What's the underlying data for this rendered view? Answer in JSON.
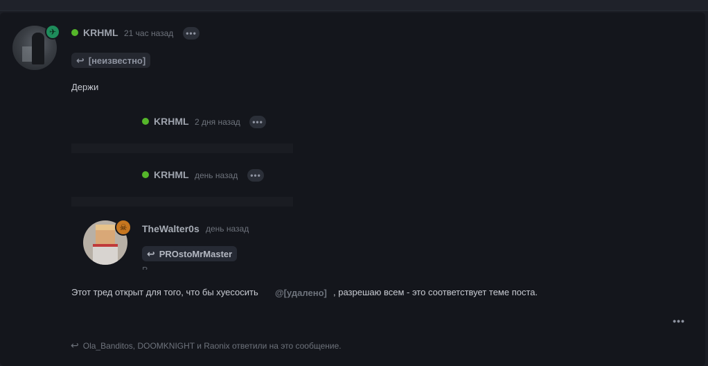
{
  "post": {
    "author": "KRHML",
    "time": "21 час назад",
    "menu_dots": "•••",
    "reply_to": "[неизвестно]",
    "text": "Держи"
  },
  "quotes": [
    {
      "author": "KRHML",
      "time": "2 дня назад",
      "menu_dots": "•••"
    },
    {
      "author": "KRHML",
      "time": "день назад",
      "menu_dots": "•••"
    }
  ],
  "nested_reply": {
    "author": "TheWalter0s",
    "time": "день назад",
    "reply_to": "PROstoMrMaster",
    "cut_text": "В…"
  },
  "body": {
    "text_before": "Этот тред открыт для того, что бы хуесосить",
    "mention": "@[удалено]",
    "text_after": ", разрешаю всем - это соответствует теме поста."
  },
  "footer": {
    "menu_dots": "•••",
    "reactions_text": "Ola_Banditos, DOOMKNIGHT и Raonix ответили на это сообщение."
  },
  "colors": {
    "online": "#55b62a",
    "badge_green": "#1e8c5b",
    "badge_orange": "#c6761f"
  },
  "icons": [
    "reply-arrow-icon",
    "online-dot-icon",
    "more-dots-icon",
    "badge-icon"
  ]
}
